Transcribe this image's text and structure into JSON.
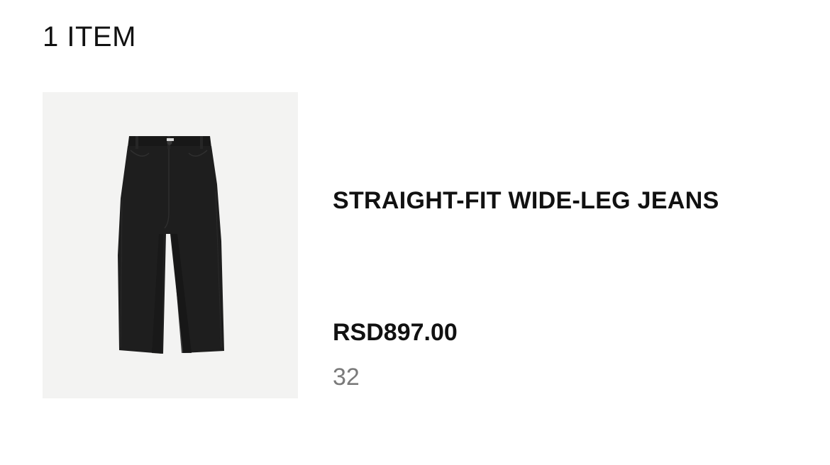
{
  "cart": {
    "count_label": "1 ITEM"
  },
  "item": {
    "name": "STRAIGHT-FIT WIDE-LEG JEANS",
    "price": "RSD897.00",
    "size": "32",
    "image_icon": "jeans-product-photo",
    "image_background": "#f3f3f2",
    "denim_color": "#1c1c1c"
  }
}
